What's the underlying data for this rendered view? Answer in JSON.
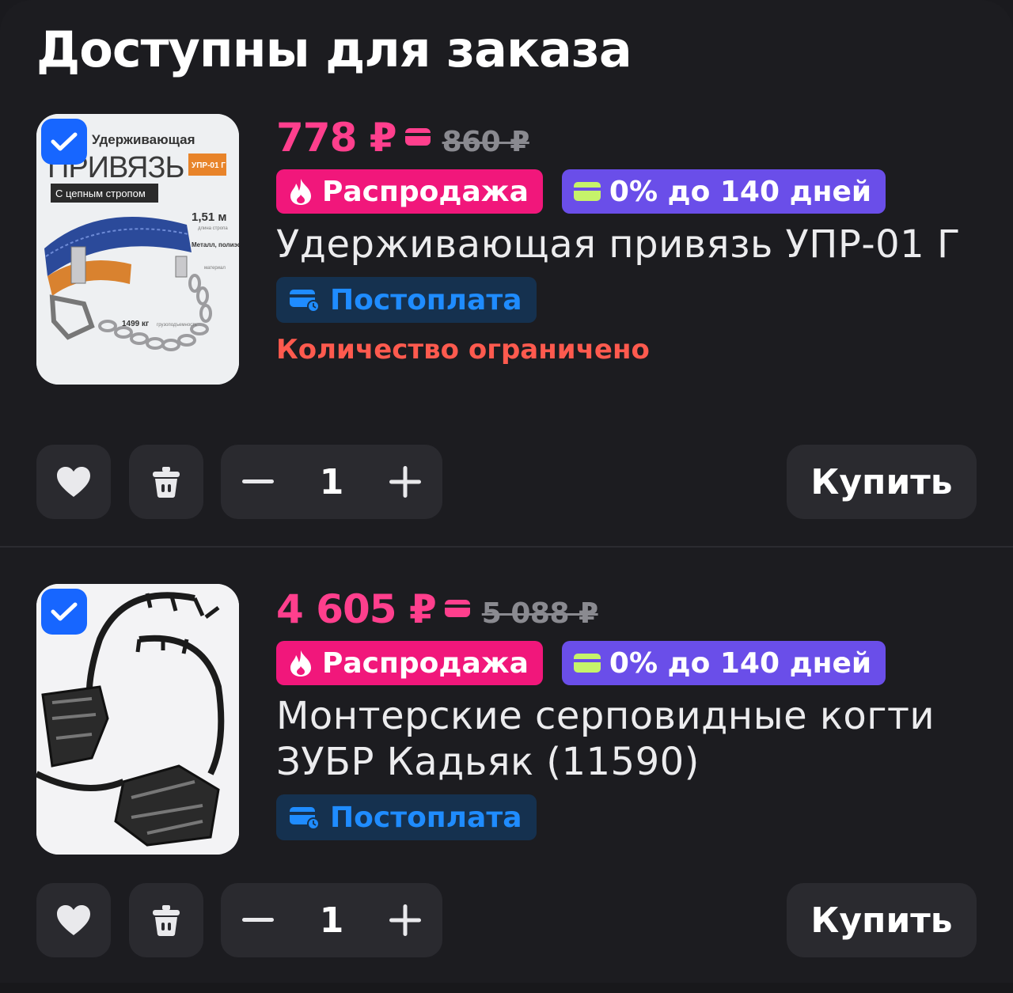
{
  "header": {
    "title": "Доступны для заказа"
  },
  "colors": {
    "accent_price": "#ff3f8d",
    "sale_badge": "#f1177b",
    "installment_badge": "#6a4ee9",
    "postpay_text": "#1f8cff",
    "limited_text": "#ff5a4e",
    "checkbox": "#1766ff"
  },
  "items": [
    {
      "selected": true,
      "price": "778 ₽",
      "old_price": "860 ₽",
      "sale_label": "Распродажа",
      "installment_label": "0% до 140 дней",
      "title": "Удерживающая привязь УПР-01 Г",
      "postpay_label": "Постоплата",
      "stock_note": "Количество ограничено",
      "quantity": "1",
      "buy_label": "Купить",
      "image": {
        "brand_top": "Удерживающая",
        "brand_main": "ПРИВЯЗЬ",
        "model_tag": "УПР-01 Г",
        "subtitle": "С цепным стропом",
        "length": "1,51 м",
        "length_caption": "длина стропа",
        "materials": "Металл, полиэфир, текстиль",
        "materials_caption": "материал",
        "load": "1499 кг",
        "load_caption": "грузоподъемность"
      }
    },
    {
      "selected": true,
      "price": "4 605 ₽",
      "old_price": "5 088 ₽",
      "sale_label": "Распродажа",
      "installment_label": "0% до 140 дней",
      "title": "Монтерские серповидные когти ЗУБР Кадьяк (11590)",
      "postpay_label": "Постоплата",
      "stock_note": "",
      "quantity": "1",
      "buy_label": "Купить"
    }
  ]
}
